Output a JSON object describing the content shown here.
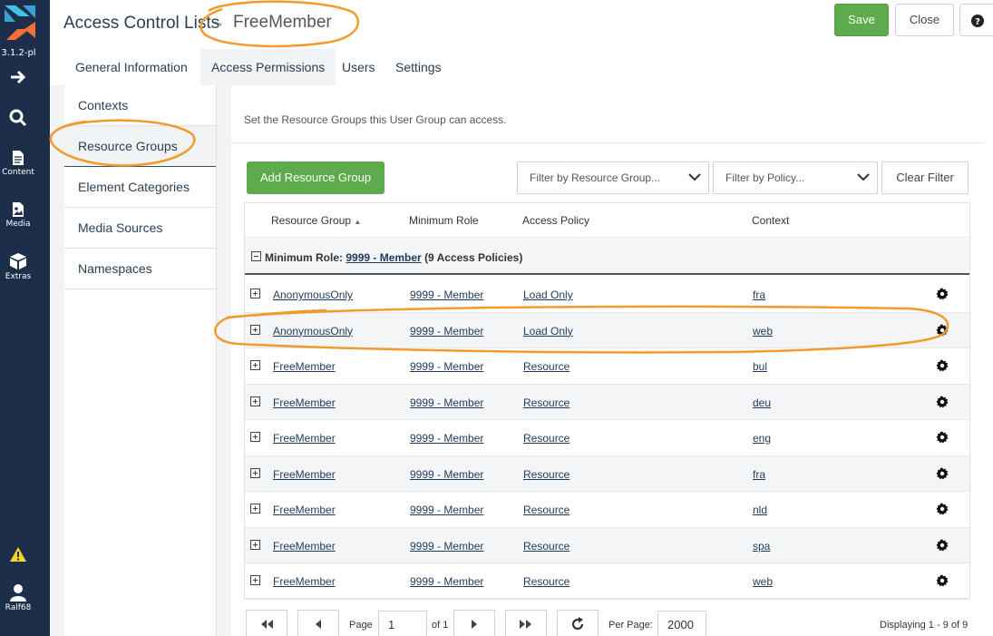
{
  "app": {
    "version": "3.1.2-pl",
    "brand_color": "#1c2e4a",
    "accent_color": "#5eab4d"
  },
  "rail": {
    "items": [
      {
        "icon": "arrow-right-icon",
        "label": ""
      },
      {
        "icon": "search-icon",
        "label": ""
      },
      {
        "icon": "content-icon",
        "label": "Content"
      },
      {
        "icon": "media-icon",
        "label": "Media"
      },
      {
        "icon": "extras-icon",
        "label": "Extras"
      }
    ],
    "warning_icon": "warning-icon",
    "user": {
      "icon": "user-icon",
      "label": "Ralf68"
    }
  },
  "header": {
    "breadcrumb": "Access Control Lists",
    "separator": ">",
    "title": "FreeMember",
    "save_label": "Save",
    "close_label": "Close",
    "help_label": "?"
  },
  "tabs": [
    {
      "label": "General Information",
      "active": false
    },
    {
      "label": "Access Permissions",
      "active": true
    },
    {
      "label": "Users",
      "active": false
    },
    {
      "label": "Settings",
      "active": false
    }
  ],
  "vtabs": [
    {
      "label": "Contexts",
      "active": false
    },
    {
      "label": "Resource Groups",
      "active": true
    },
    {
      "label": "Element Categories",
      "active": false
    },
    {
      "label": "Media Sources",
      "active": false
    },
    {
      "label": "Namespaces",
      "active": false
    }
  ],
  "panel": {
    "description": "Set the Resource Groups this User Group can access.",
    "add_button": "Add Resource Group",
    "filter_group_placeholder": "Filter by Resource Group...",
    "filter_policy_placeholder": "Filter by Policy...",
    "clear_filter": "Clear Filter"
  },
  "grid": {
    "columns": [
      "Resource Group",
      "Minimum Role",
      "Access Policy",
      "Context"
    ],
    "sort_indicator": "▲",
    "group": {
      "prefix": "Minimum Role:",
      "role": "9999 - Member",
      "count": "(9 Access Policies)"
    },
    "rows": [
      {
        "resource_group": "AnonymousOnly",
        "minimum_role": "9999 - Member",
        "access_policy": "Load Only",
        "context": "fra"
      },
      {
        "resource_group": "AnonymousOnly",
        "minimum_role": "9999 - Member",
        "access_policy": "Load Only",
        "context": "web"
      },
      {
        "resource_group": "FreeMember",
        "minimum_role": "9999 - Member",
        "access_policy": "Resource",
        "context": "bul"
      },
      {
        "resource_group": "FreeMember",
        "minimum_role": "9999 - Member",
        "access_policy": "Resource",
        "context": "deu"
      },
      {
        "resource_group": "FreeMember",
        "minimum_role": "9999 - Member",
        "access_policy": "Resource",
        "context": "eng"
      },
      {
        "resource_group": "FreeMember",
        "minimum_role": "9999 - Member",
        "access_policy": "Resource",
        "context": "fra"
      },
      {
        "resource_group": "FreeMember",
        "minimum_role": "9999 - Member",
        "access_policy": "Resource",
        "context": "nld"
      },
      {
        "resource_group": "FreeMember",
        "minimum_role": "9999 - Member",
        "access_policy": "Resource",
        "context": "spa"
      },
      {
        "resource_group": "FreeMember",
        "minimum_role": "9999 - Member",
        "access_policy": "Resource",
        "context": "web"
      }
    ]
  },
  "pager": {
    "page_label": "Page",
    "page_value": "1",
    "of_label": "of 1",
    "per_page_label": "Per Page:",
    "per_page_value": "2000",
    "displaying": "Displaying 1 - 9 of 9"
  },
  "annotations": {
    "color": "#f39a2c"
  }
}
